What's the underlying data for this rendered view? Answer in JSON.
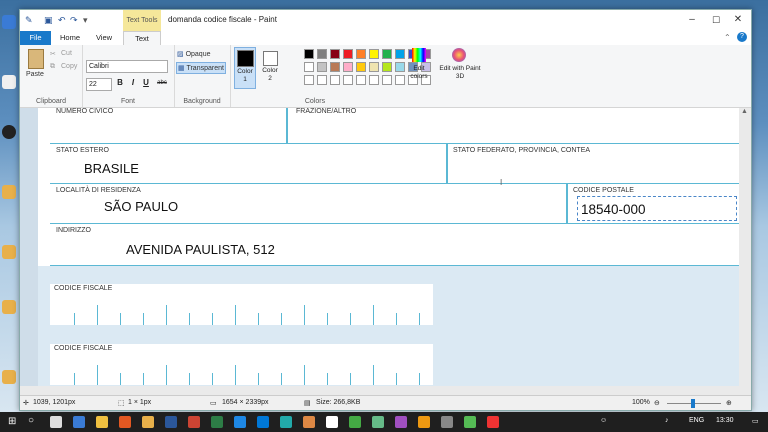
{
  "window": {
    "title": "domanda codice fiscale - Paint",
    "context_tab": "Text Tools",
    "min": "–",
    "max": "☐",
    "close": "✕"
  },
  "tabs": [
    "File",
    "Home",
    "View",
    "Text"
  ],
  "ribbon": {
    "clipboard": {
      "paste": "Paste",
      "cut": "Cut",
      "copy": "Copy",
      "label": "Clipboard"
    },
    "font": {
      "family": "Calibri",
      "size": "22",
      "bold": "B",
      "italic": "I",
      "underline": "U",
      "strike": "abc",
      "label": "Font"
    },
    "background": {
      "opaque": "Opaque",
      "transparent": "Transparent",
      "label": "Background"
    },
    "colors": {
      "color1": "Color 1",
      "color2": "Color 2",
      "edit": "Edit colors",
      "paint3d": "Edit with Paint 3D",
      "label": "Colors",
      "palette": [
        "#000000",
        "#7f7f7f",
        "#880015",
        "#ed1c24",
        "#ff7f27",
        "#fff200",
        "#22b14c",
        "#00a2e8",
        "#3f48cc",
        "#a349a4",
        "#ffffff",
        "#c3c3c3",
        "#b97a57",
        "#ffaec9",
        "#ffc90e",
        "#efe4b0",
        "#b5e61d",
        "#99d9ea",
        "#7092be",
        "#c8bfe7"
      ]
    }
  },
  "form": {
    "numero_civico_label": "NUMERO CIVICO",
    "frazione_label": "FRAZIONE/ALTRO",
    "stato_estero_label": "STATO ESTERO",
    "stato_estero_value": "BRASILE",
    "stato_federato_label": "STATO FEDERATO, PROVINCIA, CONTEA",
    "localita_label": "LOCALITÀ DI RESIDENZA",
    "localita_value": "SÃO PAULO",
    "cap_label": "CODICE POSTALE",
    "cap_value": "18540-000",
    "indirizzo_label": "INDIRIZZO",
    "indirizzo_value": "AVENIDA PAULISTA, 512",
    "cf1_label": "CODICE FISCALE",
    "cf2_label": "CODICE FISCALE"
  },
  "status": {
    "cursor": "1039, 1201px",
    "selection": "1 × 1px",
    "dimensions": "1654 × 2339px",
    "size": "Size: 266,8KB",
    "zoom": "100%"
  },
  "taskbar": {
    "lang": "ENG",
    "time": "13:30"
  }
}
